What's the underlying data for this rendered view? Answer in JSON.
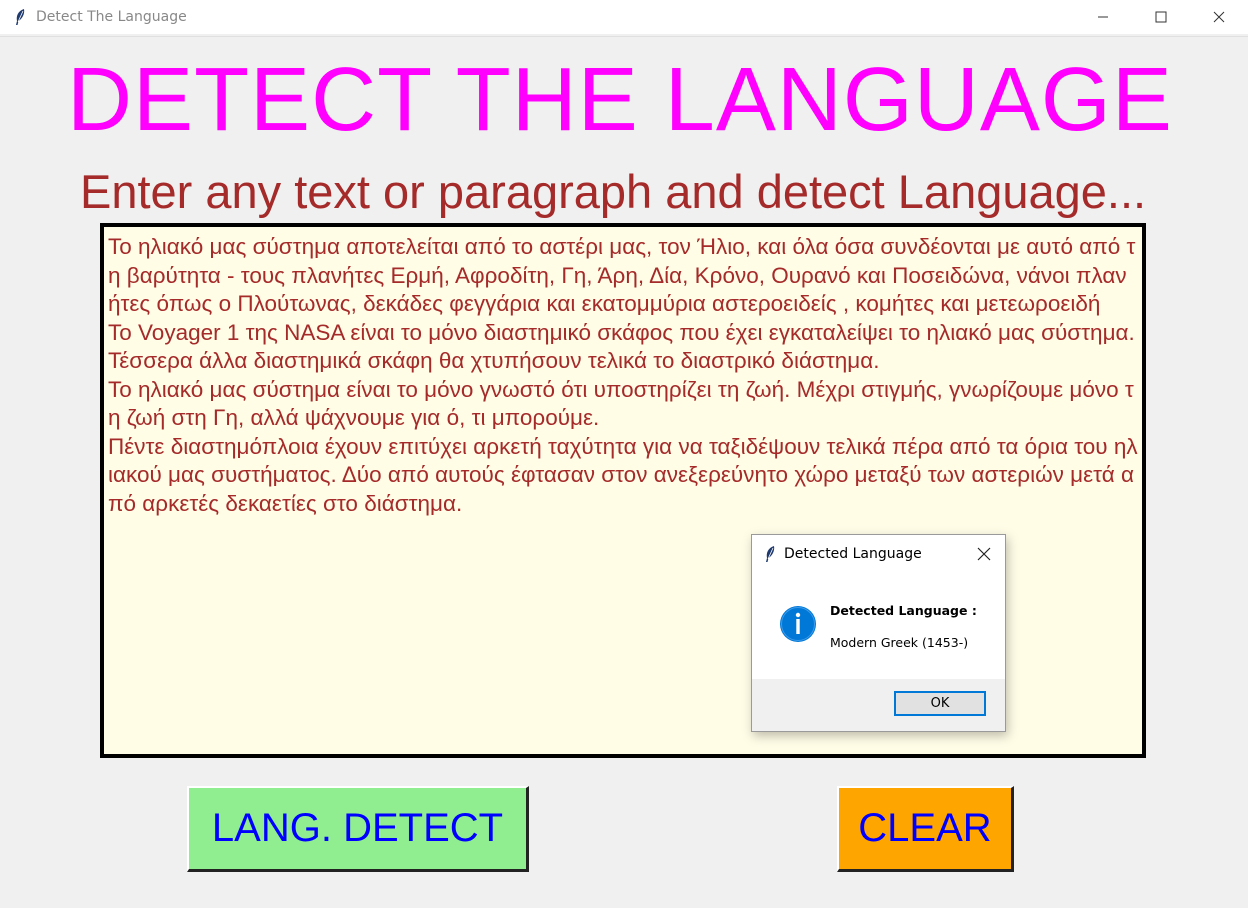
{
  "window": {
    "title": "Detect The Language",
    "controls": {
      "minimize": "minimize-icon",
      "maximize": "maximize-icon",
      "close": "close-icon"
    }
  },
  "main": {
    "heading": "DETECT THE LANGUAGE",
    "subheading": "Enter any text or paragraph and detect Language...",
    "text_input": "Το ηλιακό μας σύστημα αποτελείται από το αστέρι μας, τον Ήλιο, και όλα όσα συνδέονται με αυτό από τη βαρύτητα - τους πλανήτες Ερμή, Αφροδίτη, Γη, Άρη, Δία, Κρόνο, Ουρανό και Ποσειδώνα, νάνοι πλανήτες όπως ο Πλούτωνας, δεκάδες φεγγάρια και εκατομμύρια αστεροειδείς , κομήτες και μετεωροειδή\nΤο Voyager 1 της NASA είναι το μόνο διαστημικό σκάφος που έχει εγκαταλείψει το ηλιακό μας σύστημα. Τέσσερα άλλα διαστημικά σκάφη θα χτυπήσουν τελικά το διαστρικό διάστημα.\nΤο ηλιακό μας σύστημα είναι το μόνο γνωστό ότι υποστηρίζει τη ζωή. Μέχρι στιγμής, γνωρίζουμε μόνο τη ζωή στη Γη, αλλά ψάχνουμε για ό, τι μπορούμε.\nΠέντε διαστημόπλοια έχουν επιτύχει αρκετή ταχύτητα για να ταξιδέψουν τελικά πέρα από τα όρια του ηλιακού μας συστήματος. Δύο από αυτούς έφτασαν στον ανεξερεύνητο χώρο μεταξύ των αστεριών μετά από αρκετές δεκαετίες στο διάστημα.",
    "detect_button": "LANG. DETECT",
    "clear_button": "CLEAR"
  },
  "dialog": {
    "title": "Detected Language",
    "message_label": "Detected Language :",
    "message_value": "Modern Greek (1453-)",
    "ok_button": "OK",
    "icon": "info-icon"
  },
  "colors": {
    "heading": "#ff00ff",
    "subheading": "#a52a2a",
    "text": "#a52a2a",
    "text_bg": "#fffde6",
    "detect_bg": "#90ee90",
    "clear_bg": "#ffa500",
    "button_text": "#0000ff",
    "info_icon": "#0078d7"
  }
}
